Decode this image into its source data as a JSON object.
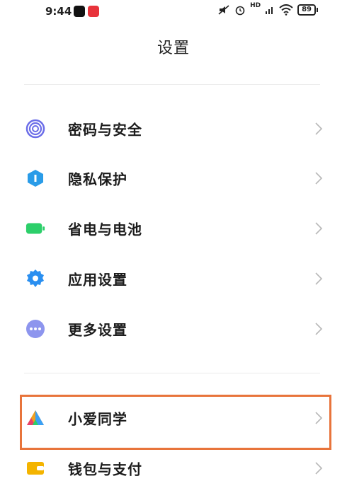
{
  "status_bar": {
    "time": "9:44",
    "battery": "89",
    "signal_label": "HD"
  },
  "page": {
    "title": "设置"
  },
  "menu": {
    "items": [
      {
        "label": "密码与安全",
        "icon": "fingerprint-icon",
        "color": "#6b6de8"
      },
      {
        "label": "隐私保护",
        "icon": "privacy-shield-icon",
        "color": "#2a9ce8"
      },
      {
        "label": "省电与电池",
        "icon": "battery-icon",
        "color": "#2ccf6a"
      },
      {
        "label": "应用设置",
        "icon": "gear-icon",
        "color": "#2a8ff0"
      },
      {
        "label": "更多设置",
        "icon": "more-dots-icon",
        "color": "#8d95ee"
      },
      {
        "label": "小爱同学",
        "icon": "xiaoai-icon",
        "color": "#f0a020"
      },
      {
        "label": "钱包与支付",
        "icon": "wallet-icon",
        "color": "#f4b400"
      }
    ]
  },
  "highlight_color": "#e8743b"
}
